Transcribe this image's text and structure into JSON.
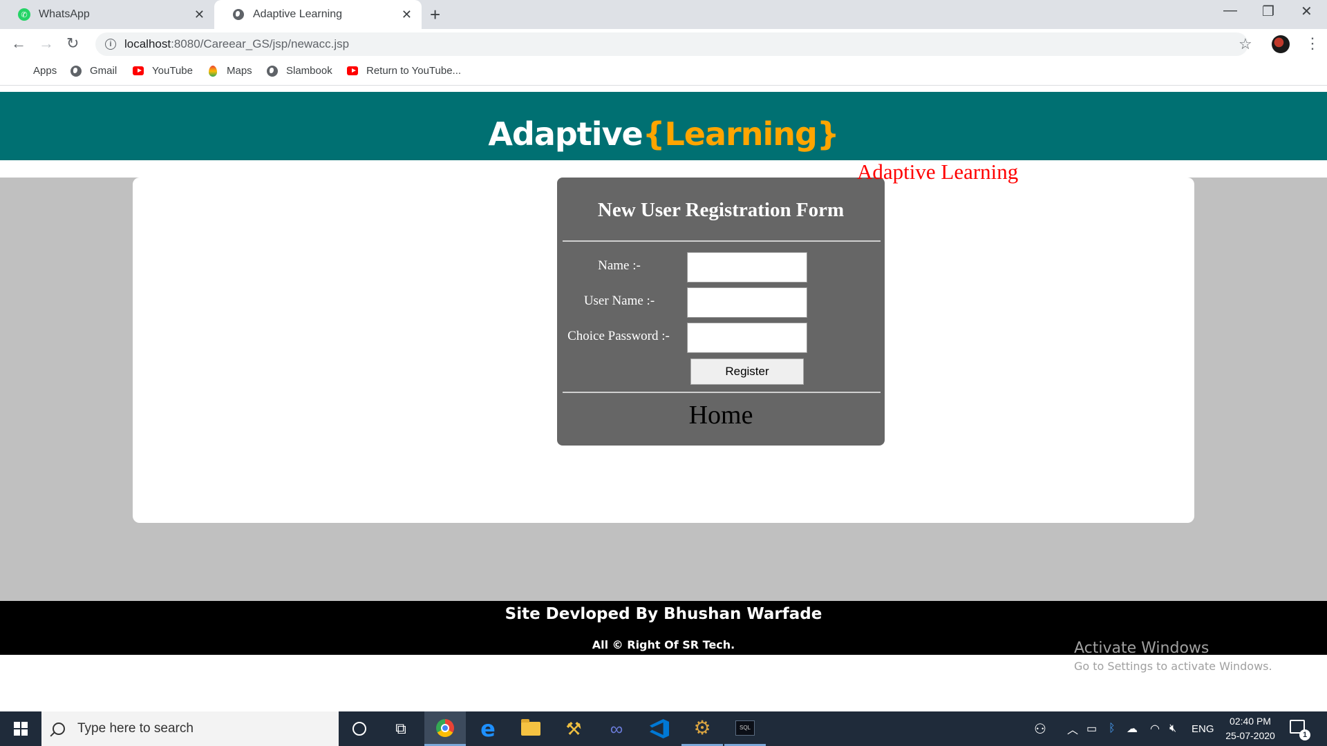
{
  "browser": {
    "tabs": [
      {
        "label": "WhatsApp",
        "icon": "whatsapp-icon",
        "active": false
      },
      {
        "label": "Adaptive Learning",
        "icon": "globe-icon",
        "active": true
      }
    ],
    "address": {
      "host": "localhost",
      "path": ":8080/Careear_GS/jsp/newacc.jsp"
    },
    "bookmarks": [
      {
        "label": "Apps",
        "icon": "apps-grid-icon"
      },
      {
        "label": "Gmail",
        "icon": "globe-icon"
      },
      {
        "label": "YouTube",
        "icon": "youtube-icon"
      },
      {
        "label": "Maps",
        "icon": "maps-pin-icon"
      },
      {
        "label": "Slambook",
        "icon": "globe-icon"
      },
      {
        "label": "Return to YouTube...",
        "icon": "youtube-icon"
      }
    ]
  },
  "page": {
    "brand_main": "Adaptive",
    "brand_accent": "{Learning}",
    "marquee": "Adaptive Learning",
    "form": {
      "title": "New User Registration Form",
      "fields": [
        {
          "label": "Name :-",
          "value": ""
        },
        {
          "label": "User Name :-",
          "value": ""
        },
        {
          "label": "Choice Password :-",
          "value": ""
        }
      ],
      "submit_label": "Register",
      "home_link": "Home"
    },
    "footer": {
      "line1": "Site Devloped By Bhushan Warfade",
      "line2": "All © Right Of SR Tech."
    },
    "watermark": {
      "title": "Activate Windows",
      "subtitle": "Go to Settings to activate Windows."
    },
    "colors": {
      "header": "#007072",
      "accent": "#ffa500",
      "form_bg": "#666666",
      "marquee": "#ff0000"
    }
  },
  "taskbar": {
    "search_placeholder": "Type here to search",
    "tray_language": "ENG",
    "time": "02:40 PM",
    "date": "25-07-2020",
    "notification_count": "1",
    "pinned": [
      "cortana-icon",
      "task-view-icon",
      "chrome-icon",
      "edge-icon",
      "file-explorer-icon",
      "tools-icon",
      "infinity-icon",
      "vscode-icon",
      "gear-app-icon",
      "mysql-icon"
    ]
  }
}
